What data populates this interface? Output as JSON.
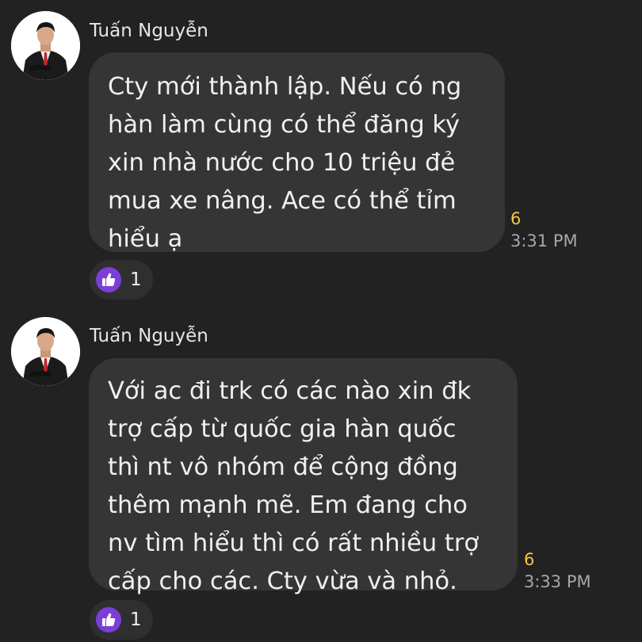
{
  "messages": [
    {
      "sender": "Tuấn Nguyễn",
      "lines": [
        "Cty mới thành lập. Nếu có ng",
        "hàn làm cùng có thể đăng ký",
        "xin nhà nước cho 10 triệu đẻ",
        "mua xe nâng. Ace có thể tỉm",
        "hiểu ạ"
      ],
      "read_count": "6",
      "time": "3:31 PM",
      "reaction": {
        "icon": "thumbs-up-icon",
        "count": "1"
      }
    },
    {
      "sender": "Tuấn Nguyễn",
      "lines": [
        "Với ac đi trk có các nào xin đk",
        "trợ cấp từ quốc gia hàn quốc",
        "thì nt vô nhóm để cộng đồng",
        "thêm mạnh mẽ. Em đang cho",
        "nv tìm hiểu thì có rất nhiều trợ",
        "cấp cho các. Cty vừa và nhỏ."
      ],
      "read_count": "6",
      "time": "3:33 PM",
      "reaction": {
        "icon": "thumbs-up-icon",
        "count": "1"
      }
    }
  ],
  "colors": {
    "background": "#222222",
    "bubble": "#353535",
    "read_count": "#f5c542",
    "like_badge": "#7b3fd8"
  }
}
